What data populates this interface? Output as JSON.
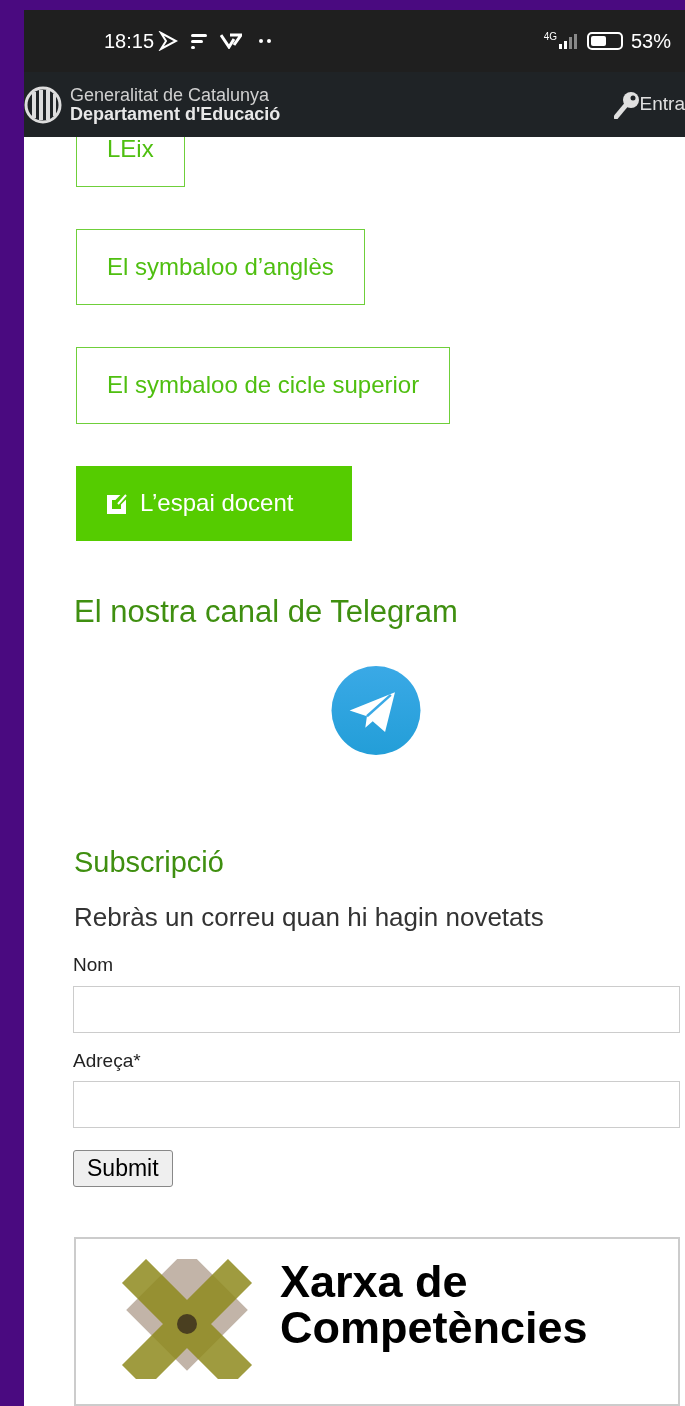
{
  "status_bar": {
    "time": "18:15",
    "network": "4G",
    "battery": "53%"
  },
  "header": {
    "org_line_1": "Generalitat de Catalunya",
    "org_line_2": "Departament d'Educació",
    "login": "Entra"
  },
  "links": [
    {
      "label": "LEix",
      "kind": "outline"
    },
    {
      "label": "El symbaloo d’anglès",
      "kind": "outline"
    },
    {
      "label": "El symbaloo de cicle superior",
      "kind": "outline"
    },
    {
      "label": "L’espai docent",
      "kind": "filled"
    }
  ],
  "telegram": {
    "heading": "El nostra canal de Telegram"
  },
  "subscription": {
    "heading": "Subscripció",
    "description": "Rebràs un correu quan hi hagin novetats",
    "fields": [
      {
        "label": "Nom"
      },
      {
        "label": "Adreça*"
      }
    ],
    "submit": "Submit"
  },
  "logo_card": {
    "line_1": "Xarxa de",
    "line_2": "Competències"
  }
}
